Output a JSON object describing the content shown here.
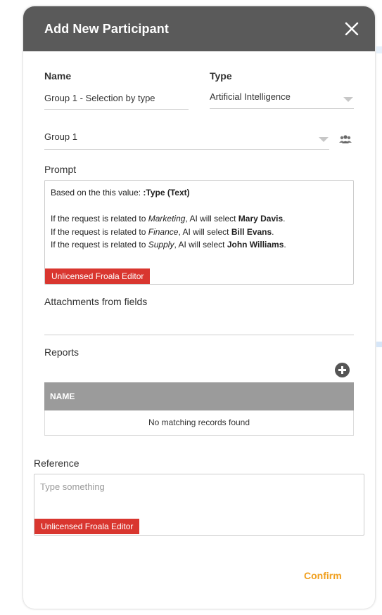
{
  "dialog": {
    "title": "Add New Participant"
  },
  "name_field": {
    "label": "Name",
    "value": "Group 1 - Selection by type"
  },
  "type_field": {
    "label": "Type",
    "value": "Artificial Intelligence"
  },
  "group_select": {
    "value": "Group 1"
  },
  "prompt": {
    "label": "Prompt",
    "line1_prefix": "Based on the this value: ",
    "line1_token": ":Type (Text)",
    "rows": [
      {
        "prefix": "If the request is related to ",
        "topic": "Marketing",
        "middle": ", AI will select ",
        "person": "Mary Davis",
        "suffix": "."
      },
      {
        "prefix": "If the request is related to ",
        "topic": "Finance",
        "middle": ", AI will select ",
        "person": "Bill Evans",
        "suffix": "."
      },
      {
        "prefix": "If the request is related to ",
        "topic": "Supply",
        "middle": ", AI will select ",
        "person": "John Williams",
        "suffix": "."
      }
    ],
    "badge": "Unlicensed Froala Editor"
  },
  "attachments": {
    "label": "Attachments from fields"
  },
  "reports": {
    "label": "Reports",
    "column_header": "NAME",
    "empty_text": "No matching records found"
  },
  "reference": {
    "label": "Reference",
    "placeholder": "Type something",
    "badge": "Unlicensed Froala Editor"
  },
  "actions": {
    "confirm_label": "Confirm"
  },
  "colors": {
    "header_bg": "#5a5a5a",
    "badge_bg": "#d9362f",
    "confirm": "#f0a020",
    "table_header_bg": "#9b9b9b"
  },
  "icons": {
    "close": "close-icon",
    "group": "group-people-icon",
    "add": "plus-circle-icon",
    "dropdown": "caret-down-icon"
  }
}
